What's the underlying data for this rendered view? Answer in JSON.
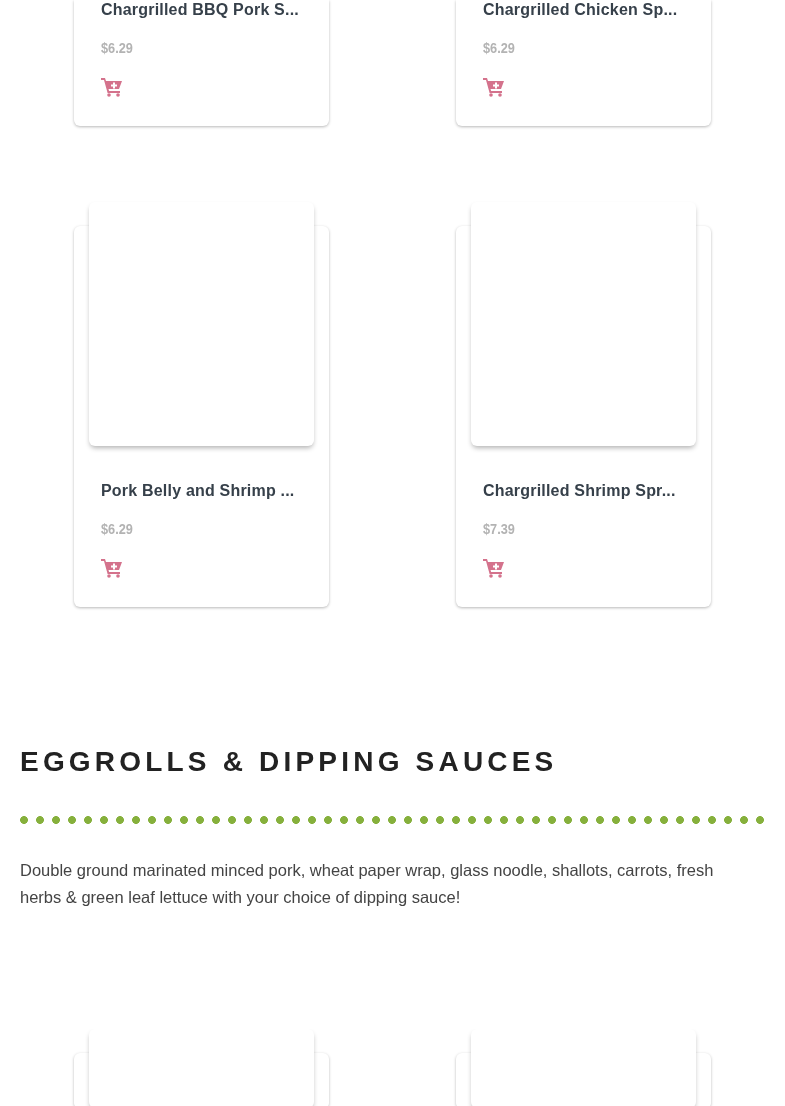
{
  "product_grid": [
    {
      "kind": "full",
      "name": "Chargrilled BBQ Pork S...",
      "price": "$6.29",
      "image_shown": false
    },
    {
      "kind": "full",
      "name": "Chargrilled Chicken Sp...",
      "price": "$6.29",
      "image_shown": false
    },
    {
      "kind": "full",
      "name": "Pork Belly and Shrimp ...",
      "price": "$6.29",
      "image_shown": true
    },
    {
      "kind": "full",
      "name": "Chargrilled Shrimp Spr...",
      "price": "$7.39",
      "image_shown": true
    }
  ],
  "section": {
    "title": "EGGROLLS & DIPPING SAUCES",
    "description": "Double ground marinated minced pork, wheat paper wrap, glass noodle, shallots, carrots, fresh herbs & green leaf lettuce with your choice of dipping sauce!",
    "products": [
      {
        "kind": "image-only",
        "image_shown": true
      },
      {
        "kind": "image-only",
        "image_shown": true
      }
    ]
  }
}
